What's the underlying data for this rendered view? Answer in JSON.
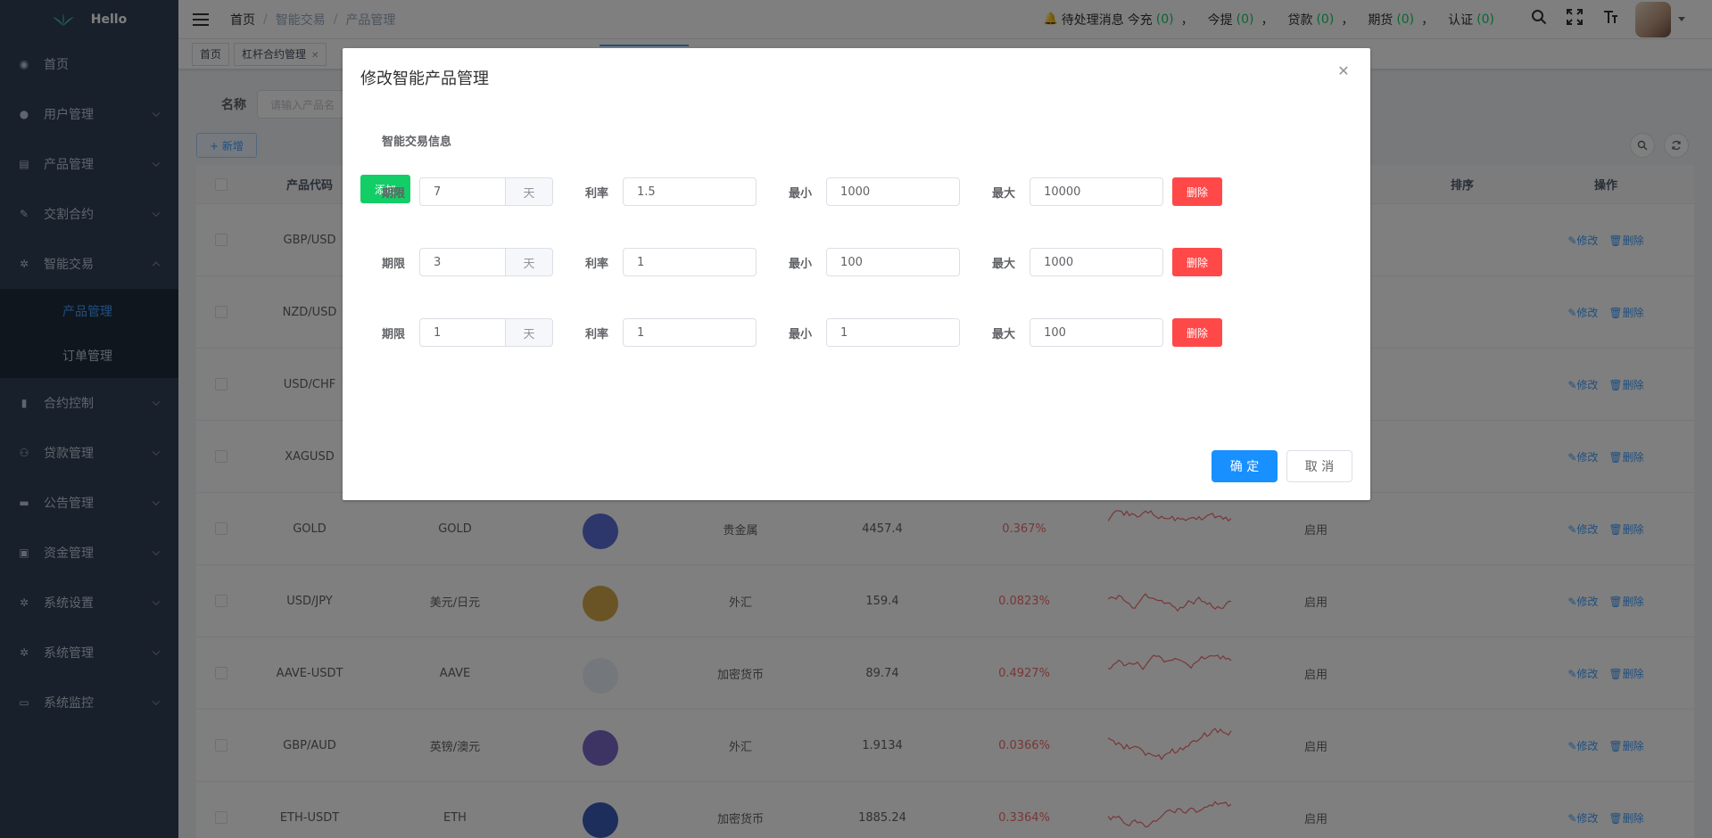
{
  "app": {
    "title": "Hello"
  },
  "sidebar": {
    "items": [
      {
        "label": "首页",
        "icon": "dashboard-icon",
        "has_arrow": false
      },
      {
        "label": "用户管理",
        "icon": "user-icon",
        "has_arrow": true
      },
      {
        "label": "产品管理",
        "icon": "document-icon",
        "has_arrow": true
      },
      {
        "label": "交割合约",
        "icon": "edit-icon",
        "has_arrow": true
      },
      {
        "label": "智能交易",
        "icon": "gear-icon",
        "has_arrow": true,
        "expanded": true
      },
      {
        "label": "合约控制",
        "icon": "bar-chart-icon",
        "has_arrow": true
      },
      {
        "label": "贷款管理",
        "icon": "people-icon",
        "has_arrow": true
      },
      {
        "label": "公告管理",
        "icon": "message-icon",
        "has_arrow": true
      },
      {
        "label": "资金管理",
        "icon": "wallet-icon",
        "has_arrow": true
      },
      {
        "label": "系统设置",
        "icon": "gear-icon",
        "has_arrow": true
      },
      {
        "label": "系统管理",
        "icon": "gear-icon",
        "has_arrow": true
      },
      {
        "label": "系统监控",
        "icon": "monitor-icon",
        "has_arrow": true
      }
    ],
    "submenu": [
      {
        "label": "产品管理",
        "active": true
      },
      {
        "label": "订单管理",
        "active": false
      }
    ],
    "active_color": "#409eff"
  },
  "header": {
    "breadcrumb": [
      "首页",
      "智能交易",
      "产品管理"
    ],
    "notice_label": "待处理消息",
    "notices": [
      {
        "label": "今充",
        "count": "(0)"
      },
      {
        "label": "今提",
        "count": "(0)"
      },
      {
        "label": "贷款",
        "count": "(0)"
      },
      {
        "label": "期货",
        "count": "(0)"
      },
      {
        "label": "认证",
        "count": "(0)"
      }
    ],
    "separator": "，"
  },
  "tags": [
    {
      "label": "首页",
      "closable": false
    },
    {
      "label": "杠杆合约管理",
      "closable": true
    }
  ],
  "search": {
    "label": "名称",
    "placeholder": "请输入产品名"
  },
  "toolbar": {
    "add_label": "+ 新增"
  },
  "table": {
    "headers": {
      "code": "产品代码",
      "sort": "排序",
      "ops": "操作"
    },
    "edit_label": "✎修改",
    "delete_label": "🗑删除",
    "rows": [
      {
        "code": "GBP/USD",
        "name": "",
        "type": "",
        "price": "",
        "change": "",
        "status": ""
      },
      {
        "code": "NZD/USD",
        "name": "",
        "type": "",
        "price": "",
        "change": "",
        "status": ""
      },
      {
        "code": "USD/CHF",
        "name": "",
        "type": "",
        "price": "",
        "change": "",
        "status": ""
      },
      {
        "code": "XAGUSD",
        "name": "",
        "type": "",
        "price": "",
        "change": "",
        "status": ""
      },
      {
        "code": "GOLD",
        "name": "GOLD",
        "type": "贵金属",
        "price": "4457.4",
        "change": "0.367%",
        "status": "启用"
      },
      {
        "code": "USD/JPY",
        "name": "美元/日元",
        "type": "外汇",
        "price": "159.4",
        "change": "0.0823%",
        "status": "启用"
      },
      {
        "code": "AAVE-USDT",
        "name": "AAVE",
        "type": "加密货币",
        "price": "89.74",
        "change": "0.4927%",
        "status": "启用"
      },
      {
        "code": "GBP/AUD",
        "name": "英镑/澳元",
        "type": "外汇",
        "price": "1.9134",
        "change": "0.0366%",
        "status": "启用"
      },
      {
        "code": "ETH-USDT",
        "name": "ETH",
        "type": "加密货币",
        "price": "1885.24",
        "change": "0.3364%",
        "status": "启用"
      }
    ],
    "change_color": "#f56c6c"
  },
  "dialog": {
    "title": "修改智能产品管理",
    "section": "智能交易信息",
    "add_label": "添加",
    "period_label": "期限",
    "unit": "天",
    "rate_label": "利率",
    "min_label": "最小",
    "max_label": "最大",
    "delete_label": "删除",
    "rules": [
      {
        "period": "7",
        "rate": "1.5",
        "min": "1000",
        "max": "10000"
      },
      {
        "period": "3",
        "rate": "1",
        "min": "100",
        "max": "1000"
      },
      {
        "period": "1",
        "rate": "1",
        "min": "1",
        "max": "100"
      }
    ],
    "confirm_label": "确 定",
    "cancel_label": "取 消",
    "add_color": "#13ce66",
    "delete_color": "#ff4949",
    "primary_color": "#1890ff"
  }
}
